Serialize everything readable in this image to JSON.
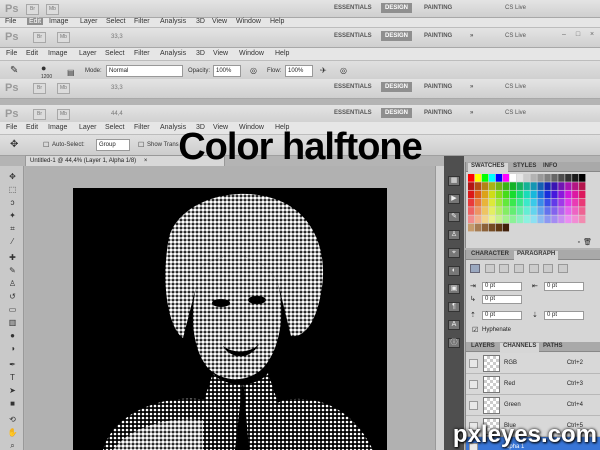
{
  "app": {
    "logo": "Ps",
    "icons": [
      "Br",
      "Mb"
    ],
    "zoom_values": [
      "33,3",
      "33,3",
      "33,3",
      "44,4"
    ],
    "workspaces": [
      "ESSENTIALS",
      "DESIGN",
      "PAINTING"
    ],
    "more": "»",
    "cs_live": "CS Live",
    "win_buttons": [
      "–",
      "□",
      "×"
    ]
  },
  "menu": [
    "File",
    "Edit",
    "Image",
    "Layer",
    "Select",
    "Filter",
    "Analysis",
    "3D",
    "View",
    "Window",
    "Help"
  ],
  "brush_options": {
    "brush_size": "1200",
    "mode_label": "Mode:",
    "mode_value": "Normal",
    "opacity_label": "Opacity:",
    "opacity_value": "100%",
    "flow_label": "Flow:",
    "flow_value": "100%"
  },
  "move_options": {
    "auto_select_label": "Auto-Select:",
    "auto_select_value": "Group",
    "show_transform": "Show Trans"
  },
  "document": {
    "tab_title": "Untitled-1 @ 44,4% (Layer 1, Alpha 1/8)",
    "close": "×"
  },
  "overlay_title": "Color halftone",
  "watermark": "pxleyes.com",
  "swatches_panel": {
    "tabs": [
      "SWATCHES",
      "STYLES",
      "INFO"
    ]
  },
  "character_panel": {
    "tabs": [
      "CHARACTER",
      "PARAGRAPH"
    ],
    "fields": [
      "0 pt",
      "0 pt",
      "0 pt",
      "0 pt",
      "0 pt"
    ],
    "hyphenate_label": "Hyphenate",
    "hyphenate_checked": true
  },
  "channels_panel": {
    "tabs": [
      "LAYERS",
      "CHANNELS",
      "PATHS"
    ],
    "rows": [
      {
        "name": "RGB",
        "key": "Ctrl+2"
      },
      {
        "name": "Red",
        "key": "Ctrl+3"
      },
      {
        "name": "Green",
        "key": "Ctrl+4"
      },
      {
        "name": "Blue",
        "key": "Ctrl+5"
      },
      {
        "name": "Alpha 1",
        "key": ""
      }
    ]
  },
  "colors": {
    "dock": "#4f4f4f",
    "workspace_active": "#8f8f8f",
    "selection": "#3875d7"
  }
}
